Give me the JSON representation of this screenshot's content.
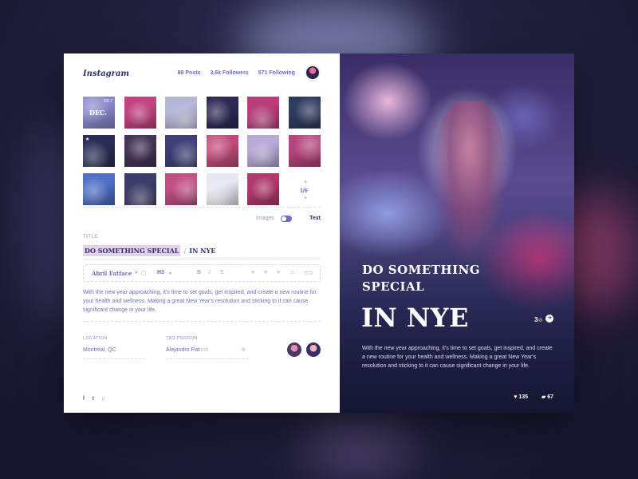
{
  "header": {
    "logo": "Instagram",
    "posts": "88 Posts",
    "followers": "3.6k Followers",
    "following": "571 Following"
  },
  "grid": {
    "first_tile_year": "2017",
    "first_tile_label": "DEC.",
    "pager": "1/6",
    "tile_colors": [
      "#8a86c9",
      "#c2437f",
      "#b6b6d9",
      "#2c2a55",
      "#b93e7b",
      "#2f3b5f",
      "#2a2d55",
      "#433455",
      "#3f3e78",
      "#c04b7a",
      "#b7a9d8",
      "#b5427a",
      "#4f6fc7",
      "#3d3d6a",
      "#c24f84",
      "#e8e8f3",
      "#b03a6c"
    ]
  },
  "toggle": {
    "left_label": "Images",
    "right_label": "Text"
  },
  "editor": {
    "title_label": "TITLE",
    "title_part1": "DO SOMETHING SPECIAL",
    "title_sep": "/",
    "title_part2": "IN NYE",
    "font_name": "Abril Fatface",
    "heading_level": "H3",
    "body": "With the new year approaching, it's time to set goals, get inspired, and create a new routine for your health and wellness. Making a great New Year's resolution and sticking to it can cause significant change in your life."
  },
  "fields": {
    "location_label": "LOCATION",
    "location_value": "Montreal, QC",
    "tag_label": "TAG PERSON",
    "tag_value": "Alejandro Pat",
    "tag_suffix": "inol"
  },
  "social": [
    "f",
    "t",
    "p"
  ],
  "hero": {
    "line1": "DO SOMETHING",
    "line2": "SPECIAL",
    "big": "IN NYE",
    "count_current": "3",
    "count_total": "/8",
    "body": "With the new year approaching, it's time to set goals, get inspired, and create a new routine for your health and wellness. Making a great New Year's resolution and sticking to it can cause significant change in your life.",
    "likes": "135",
    "comments": "67"
  }
}
